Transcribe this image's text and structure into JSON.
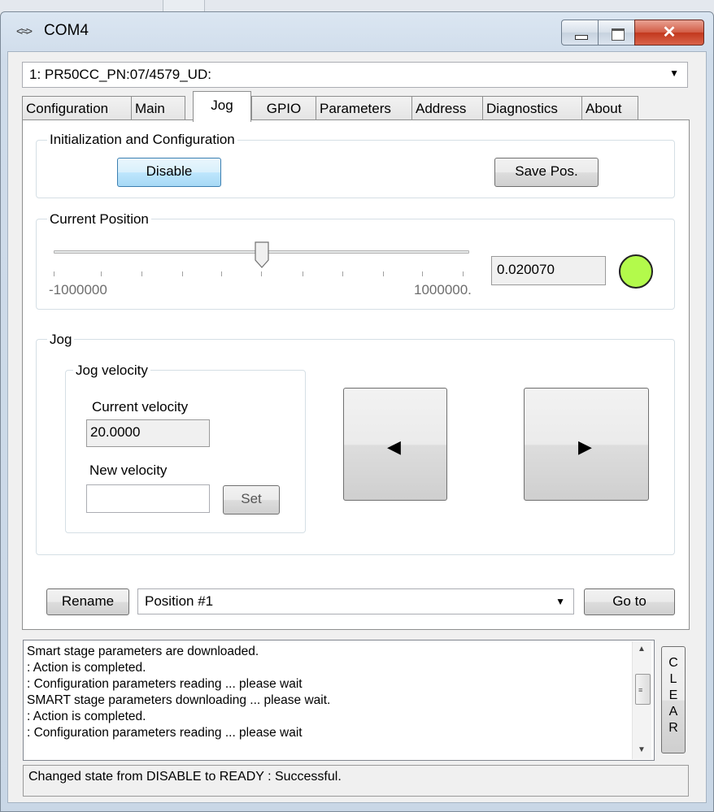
{
  "window": {
    "title": "COM4",
    "title_icon": "serial-port-icon",
    "controls": {
      "minimize": "minimize-icon",
      "maximize": "maximize-icon",
      "close": "✕"
    }
  },
  "device": {
    "selected": "1: PR50CC_PN:07/4579_UD:"
  },
  "tabs": [
    {
      "label": "Configuration",
      "active": false
    },
    {
      "label": "Main",
      "active": false
    },
    {
      "label": "Jog",
      "active": true
    },
    {
      "label": "GPIO",
      "active": false
    },
    {
      "label": "Parameters",
      "active": false
    },
    {
      "label": "Address",
      "active": false
    },
    {
      "label": "Diagnostics",
      "active": false
    },
    {
      "label": "About",
      "active": false
    }
  ],
  "init": {
    "legend": "Initialization and Configuration",
    "disable_label": "Disable",
    "save_pos_label": "Save Pos."
  },
  "position": {
    "legend": "Current Position",
    "min_label": "-1000000",
    "max_label": "1000000.",
    "slider_fraction": 0.5,
    "value": "0.020070",
    "status_color": "#b3fa4b"
  },
  "jog": {
    "legend": "Jog",
    "velocity_legend": "Jog velocity",
    "current_velocity_label": "Current velocity",
    "current_velocity_value": "20.0000",
    "new_velocity_label": "New velocity",
    "new_velocity_value": "",
    "set_label": "Set",
    "left_arrow": "◀",
    "right_arrow": "▶"
  },
  "positions": {
    "rename_label": "Rename",
    "selected": "Position #1",
    "goto_label": "Go to"
  },
  "log": {
    "lines": [
      "Smart stage parameters are downloaded.",
      ": Action is completed.",
      ": Configuration parameters reading ... please wait",
      "SMART stage parameters downloading ... please wait.",
      ": Action is completed.",
      ": Configuration parameters reading ... please wait"
    ],
    "clear_letters": [
      "C",
      "L",
      "E",
      "A",
      "R"
    ]
  },
  "status_text": "Changed state from DISABLE to READY : Successful."
}
